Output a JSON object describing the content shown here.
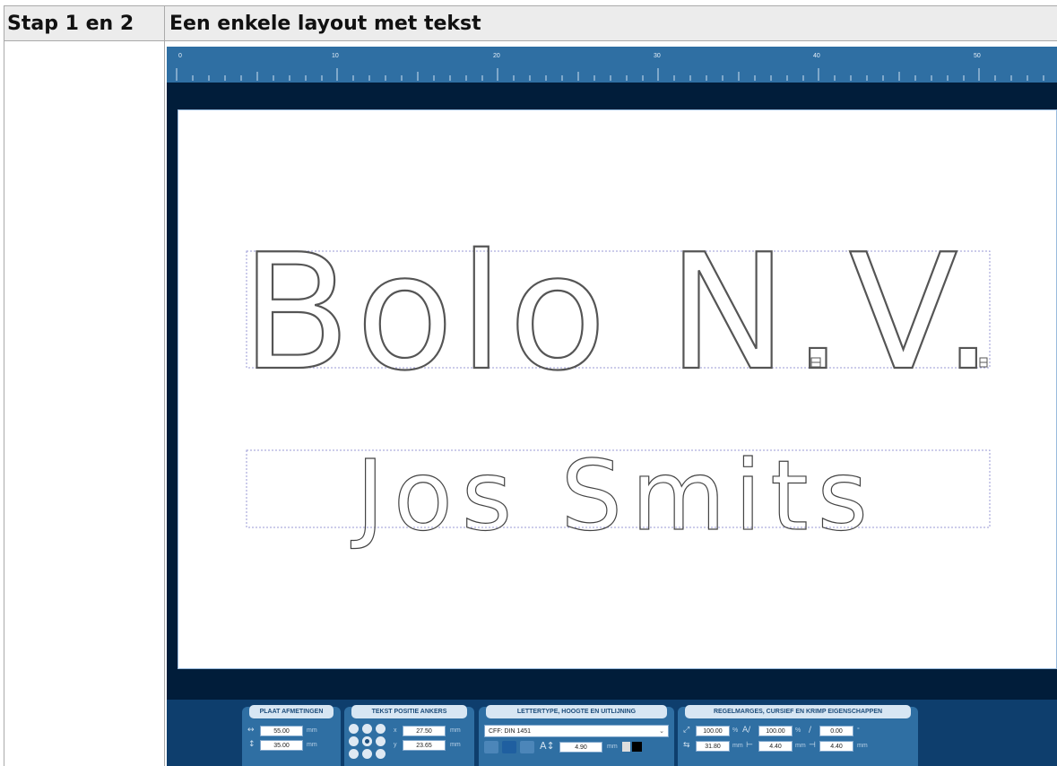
{
  "table": {
    "col1_header": "Stap 1 en 2",
    "col2_header": "Een enkele layout met tekst"
  },
  "editor": {
    "ruler_labels": [
      "0",
      "10",
      "20",
      "30",
      "40",
      "50"
    ],
    "canvas": {
      "line1": "Bolo N.V.",
      "line2": "Jos Smits"
    },
    "panels": {
      "plaat": {
        "title": "PLAAT AFMETINGEN",
        "width": "55.00",
        "height": "35.00",
        "unit": "mm"
      },
      "positie": {
        "title": "TEKST POSITIE ANKERS",
        "x_label": "x",
        "y_label": "y",
        "x": "27.50",
        "y": "23.65",
        "unit": "mm"
      },
      "lettertype": {
        "title": "LETTERTYPE, HOOGTE EN UITLIJNING",
        "font": "CFF: DIN 1451",
        "height": "4.90",
        "unit": "mm"
      },
      "regelmarges": {
        "title": "REGELMARGES, CURSIEF EN KRIMP EIGENSCHAPPEN",
        "scale_x": "100.00",
        "scale_y": "100.00",
        "italic": "0.00",
        "spacing": "31.80",
        "margin_left": "4.40",
        "margin_right": "4.40",
        "unit_pct": "%",
        "unit_mm": "mm",
        "unit_deg": "°"
      }
    }
  },
  "colors": {
    "editor_bg": "#011d3a",
    "ruler": "#2f6fa3",
    "panel": "#2f6fa3",
    "header_bg": "#ececec"
  }
}
